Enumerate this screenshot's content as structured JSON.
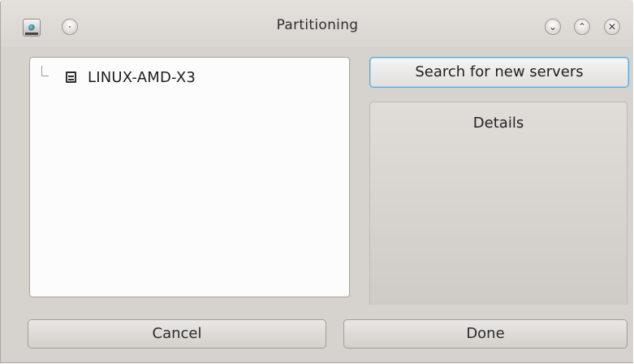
{
  "window": {
    "title": "Partitioning",
    "titlebar_buttons": {
      "minimize_glyph": "⌄",
      "maximize_glyph": "⌃",
      "close_glyph": "✕"
    }
  },
  "server_tree": {
    "items": [
      {
        "label": "LINUX-AMD-X3",
        "icon": "computer-icon"
      }
    ]
  },
  "actions": {
    "search_label": "Search for new servers",
    "cancel_label": "Cancel",
    "done_label": "Done"
  },
  "details": {
    "title": "Details"
  },
  "colors": {
    "window_bg": "#d6d2cd",
    "focus_accent": "#5aa9d8",
    "list_bg": "#fcfcfc"
  }
}
